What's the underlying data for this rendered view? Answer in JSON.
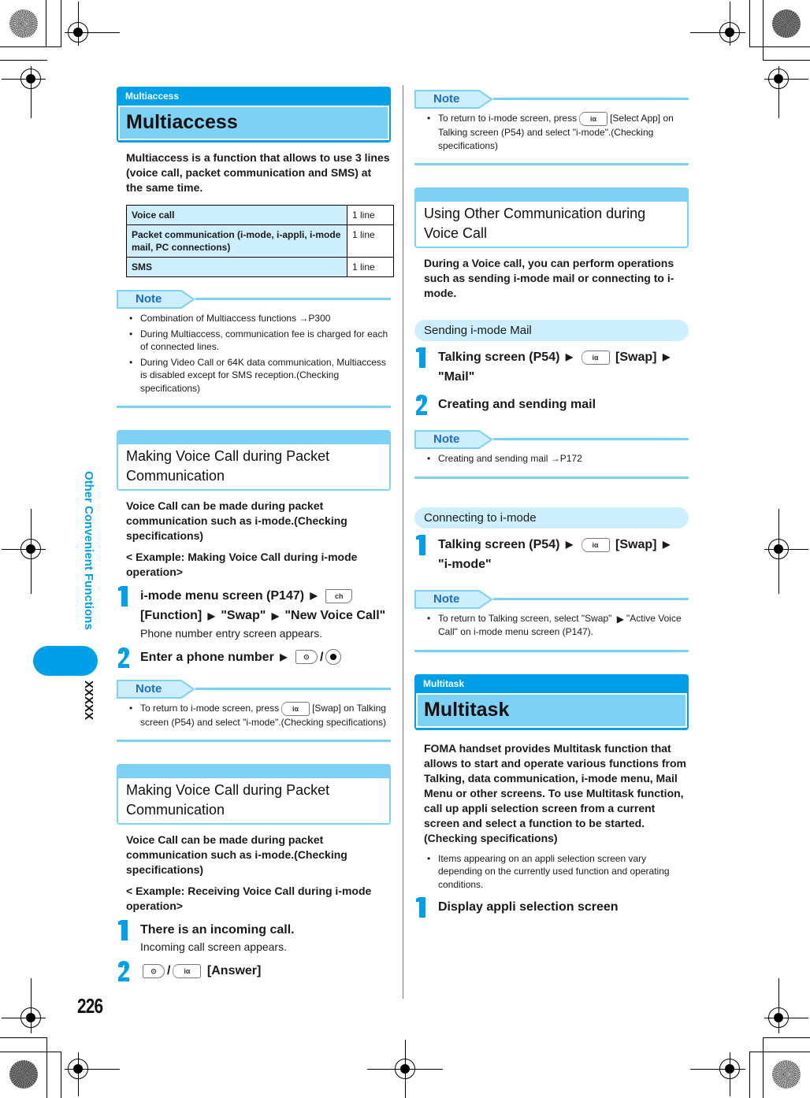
{
  "side": {
    "chapter": "Other Convenient Functions",
    "tab_code": "XXXXX"
  },
  "page_number": "226",
  "left": {
    "multiaccess": {
      "small_title": "Multiaccess",
      "title": "Multiaccess",
      "lead": "Multiaccess is a function that allows to use 3 lines (voice call, packet communication and SMS) at the same time.",
      "table": [
        {
          "label": "Voice call",
          "value": "1 line"
        },
        {
          "label": "Packet communication (i-mode, i-appli, i-mode mail, PC connections)",
          "value": "1 line"
        },
        {
          "label": "SMS",
          "value": "1 line"
        }
      ],
      "note_label": "Note",
      "notes": [
        "Combination of Multiaccess functions →P300",
        "During Multiaccess, communication fee is charged for each of connected lines.",
        "During Video Call or 64K data communication, Multiaccess is disabled except for SMS reception.(Checking specifications)"
      ]
    },
    "making_call": {
      "title": "Making Voice Call during Packet Communication",
      "lead": "Voice Call can be made during packet communication such as i-mode.(Checking specifications)",
      "example": "< Example: Making Voice Call during i-mode operation>",
      "step1_a": "i-mode menu screen (P147)",
      "step1_b": "[Function]",
      "step1_c": "\"Swap\"",
      "step1_d": "\"New Voice Call\"",
      "step1_desc": "Phone number entry screen appears.",
      "step2_a": "Enter a phone number",
      "step2_sep": "/",
      "note_label": "Note",
      "note_a": "To return to i-mode screen, press",
      "note_b": "[Swap] on Talking screen (P54) and select \"i-mode\".(Checking specifications)"
    },
    "receiving_call": {
      "title": "Making Voice Call during Packet Communication",
      "lead": "Voice Call can be made during packet communication such as i-mode.(Checking specifications)",
      "example": "< Example: Receiving Voice Call during i-mode operation>",
      "step1": "There is an incoming call.",
      "step1_desc": "Incoming call screen appears.",
      "step2_sep": "/",
      "step2_b": "[Answer]"
    }
  },
  "right": {
    "top_note": {
      "label": "Note",
      "text_a": "To return to i-mode screen, press",
      "text_b": "[Select App] on Talking screen (P54) and select \"i-mode\".(Checking specifications)"
    },
    "other_comm": {
      "title": "Using Other Communication during Voice Call",
      "lead": "During a Voice call, you can perform operations such as sending i-mode mail or connecting to i-mode."
    },
    "sending_mail": {
      "pill": "Sending i-mode Mail",
      "step1_a": "Talking screen (P54)",
      "step1_b": "[Swap]",
      "step1_c": "\"Mail\"",
      "step2": "Creating and sending mail",
      "note_label": "Note",
      "note": "Creating and sending mail →P172"
    },
    "connecting": {
      "pill": "Connecting to i-mode",
      "step1_a": "Talking screen (P54)",
      "step1_b": "[Swap]",
      "step1_c": "\"i-mode\"",
      "note_label": "Note",
      "note_a": "To return to Talking screen, select \"Swap\"",
      "note_b": "\"Active Voice Call\" on i-mode menu screen (P147)."
    },
    "multitask": {
      "small_title": "Multitask",
      "title": "Multitask",
      "lead": "FOMA handset provides Multitask function that allows to start and operate various functions from Talking, data communication, i-mode menu, Mail Menu or other screens. To use Multitask function, call up appli selection screen from a current screen and select a function to be started. (Checking specifications)",
      "bullet": "Items appearing on an appli selection screen vary depending on the currently used function and operating conditions.",
      "step1": "Display appli selection screen"
    }
  },
  "colors": {
    "accent": "#00a0e9",
    "light": "#7cd1f5",
    "pale": "#cdeefc",
    "note_text": "#1a6fc4"
  }
}
